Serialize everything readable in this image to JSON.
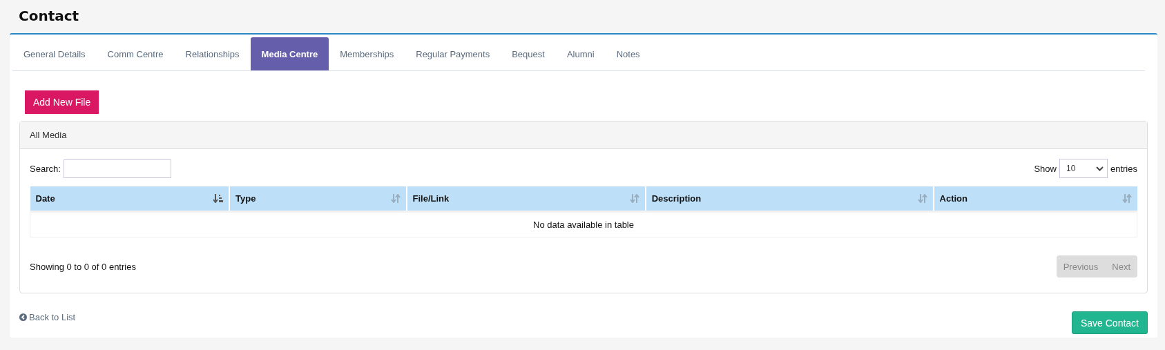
{
  "page": {
    "title": "Contact"
  },
  "tabs": [
    {
      "label": "General Details",
      "selected": false
    },
    {
      "label": "Comm Centre",
      "selected": false
    },
    {
      "label": "Relationships",
      "selected": false
    },
    {
      "label": "Media Centre",
      "selected": true
    },
    {
      "label": "Memberships",
      "selected": false
    },
    {
      "label": "Regular Payments",
      "selected": false
    },
    {
      "label": "Bequest",
      "selected": false
    },
    {
      "label": "Alumni",
      "selected": false
    },
    {
      "label": "Notes",
      "selected": false
    }
  ],
  "add_button": "Add New File",
  "panel": {
    "title": "All Media",
    "search": {
      "label": "Search:"
    },
    "length": {
      "before": "Show",
      "value": "10",
      "after": "entries"
    },
    "table": {
      "columns": [
        {
          "label": "Date",
          "sorted": true
        },
        {
          "label": "Type",
          "sorted": false
        },
        {
          "label": "File/Link",
          "sorted": false
        },
        {
          "label": "Description",
          "sorted": false
        },
        {
          "label": "Action",
          "sorted": false
        }
      ],
      "empty_message": "No data available in table"
    },
    "info": "Showing 0 to 0 of 0 entries",
    "pagination": [
      {
        "label": "Previous",
        "disabled": true
      },
      {
        "label": "Next",
        "disabled": true
      }
    ]
  },
  "back_link": "Back to List",
  "save_button": "Save Contact"
}
